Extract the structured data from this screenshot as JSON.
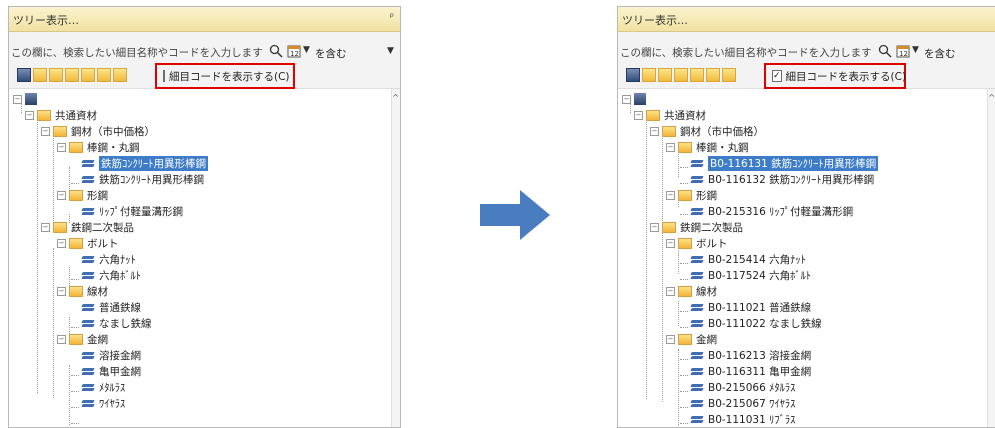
{
  "panels": [
    {
      "title": "ツリー表示…",
      "pin": "ᵖ",
      "search_placeholder": "この欄に、検索したい細目名称やコードを入力します",
      "match_mode": "を含む",
      "show_code_label": "細目コードを表示する(C)",
      "show_code_checked": "",
      "tree": {
        "root": "共通資材",
        "category1": "鋼材（市中価格）",
        "group_bars": "棒鋼・丸鋼",
        "bar1": "鉄筋ｺﾝｸﾘｰﾄ用異形棒鋼",
        "bar2": "鉄筋ｺﾝｸﾘｰﾄ用異形棒鋼",
        "group_shapes": "形鋼",
        "shape1": "ﾘｯﾌﾟ付軽量溝形鋼",
        "category2": "鉄鋼二次製品",
        "group_bolts": "ボルト",
        "bolt1": "六角ﾅｯﾄ",
        "bolt2": "六角ﾎﾞﾙﾄ",
        "group_wire": "線材",
        "wire1": "普通鉄線",
        "wire2": "なまし鉄線",
        "group_mesh": "金網",
        "mesh1": "溶接金網",
        "mesh2": "亀甲金網",
        "mesh3": "ﾒﾀﾙﾗｽ",
        "mesh4": "ﾜｲﾔﾗｽ"
      }
    },
    {
      "title": "ツリー表示…",
      "pin": "ᵖ",
      "search_placeholder": "この欄に、検索したい細目名称やコードを入力します",
      "match_mode": "を含む",
      "show_code_label": "細目コードを表示する(C)",
      "show_code_checked": "✓",
      "tree": {
        "root": "共通資材",
        "category1": "鋼材（市中価格）",
        "group_bars": "棒鋼・丸鋼",
        "bar1": "B0-116131 鉄筋ｺﾝｸﾘｰﾄ用異形棒鋼",
        "bar2": "B0-116132 鉄筋ｺﾝｸﾘｰﾄ用異形棒鋼",
        "group_shapes": "形鋼",
        "shape1": "B0-215316 ﾘｯﾌﾟ付軽量溝形鋼",
        "category2": "鉄鋼二次製品",
        "group_bolts": "ボルト",
        "bolt1": "B0-215414 六角ﾅｯﾄ",
        "bolt2": "B0-117524 六角ﾎﾞﾙﾄ",
        "group_wire": "線材",
        "wire1": "B0-111021 普通鉄線",
        "wire2": "B0-111022 なまし鉄線",
        "group_mesh": "金網",
        "mesh1": "B0-116213 溶接金網",
        "mesh2": "B0-116311 亀甲金網",
        "mesh3": "B0-215066 ﾒﾀﾙﾗｽ",
        "mesh4": "B0-215067 ﾜｲﾔﾗｽ",
        "mesh5": "B0-111031 ﾘﾌﾞﾗｽ"
      }
    }
  ],
  "colors": {
    "highlight": "#e00000",
    "selection": "#3d7cc9",
    "arrow": "#4a7cc0"
  }
}
